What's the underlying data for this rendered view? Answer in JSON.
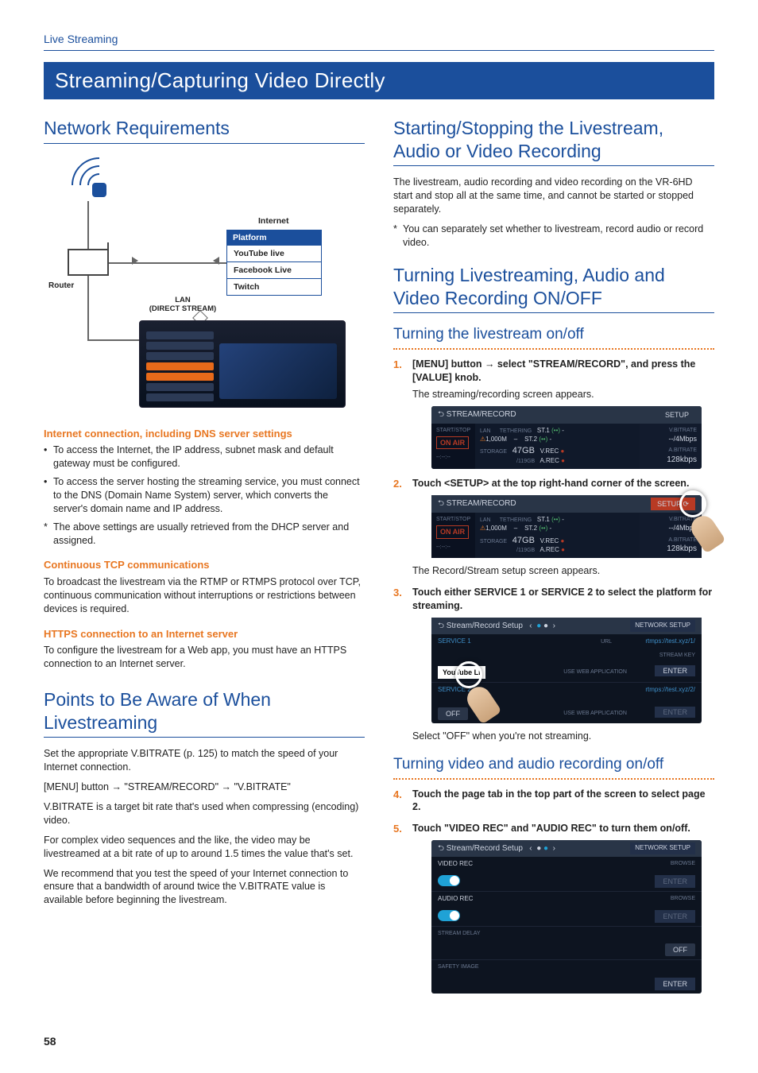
{
  "sectionLabel": "Live Streaming",
  "pageTitle": "Streaming/Capturing Video Directly",
  "pageNumber": "58",
  "left": {
    "h_network": "Network Requirements",
    "diagram": {
      "router": "Router",
      "internet": "Internet",
      "platform_head": "Platform",
      "platforms": [
        "YouTube live",
        "Facebook Live",
        "Twitch"
      ],
      "lan1": "LAN",
      "lan2": "(DIRECT STREAM)"
    },
    "h_internet": "Internet connection, including DNS server settings",
    "internet_b1": "To access the Internet, the IP address, subnet mask and default gateway must be configured.",
    "internet_b2": "To access the server hosting the streaming service, you must connect to the DNS (Domain Name System) server, which converts the server's domain name and IP address.",
    "internet_note": "The above settings are usually retrieved from the DHCP server and assigned.",
    "h_tcp": "Continuous TCP communications",
    "tcp_p": "To broadcast the livestream via the RTMP or RTMPS protocol over TCP, continuous communication without interruptions or restrictions between devices is required.",
    "h_https": "HTTPS connection to an Internet server",
    "https_p": "To configure the livestream for a Web app, you must have an HTTPS connection to an Internet server.",
    "h_points": "Points to Be Aware of When Livestreaming",
    "points_p1": "Set the appropriate V.BITRATE (p. 125) to match the speed of your Internet connection.",
    "points_p2": "[MENU] button → \"STREAM/RECORD\" → \"V.BITRATE\"",
    "points_p3": "V.BITRATE is a target bit rate that's used when compressing (encoding) video.",
    "points_p4": "For complex video sequences and the like, the video may be livestreamed at a bit rate of up to around 1.5 times the value that's set.",
    "points_p5": "We recommend that you test the speed of your Internet connection to ensure that a bandwidth of around twice the V.BITRATE value is available before beginning the livestream."
  },
  "right": {
    "h_start": "Starting/Stopping the Livestream, Audio or Video Recording",
    "start_p1": "The livestream, audio recording and video recording on the VR-6HD start and stop all at the same time, and cannot be started or stopped separately.",
    "start_note": "You can separately set whether to livestream, record audio or record video.",
    "h_turn": "Turning Livestreaming, Audio and Video Recording ON/OFF",
    "h_ls": "Turning the livestream on/off",
    "step1_num": "1.",
    "step1": "[MENU] button → select \"STREAM/RECORD\", and press the [VALUE] knob.",
    "step1_note": "The streaming/recording screen appears.",
    "step2_num": "2.",
    "step2": "Touch <SETUP> at the top right-hand corner of the screen.",
    "step2_note": "The Record/Stream setup screen appears.",
    "step3_num": "3.",
    "step3": "Touch either SERVICE 1 or SERVICE 2 to select the platform for streaming.",
    "step3_note": "Select \"OFF\" when you're not streaming.",
    "h_va": "Turning video and audio recording on/off",
    "step4_num": "4.",
    "step4": "Touch the page tab in the top part of the screen to select page 2.",
    "step5_num": "5.",
    "step5": "Touch \"VIDEO REC\" and \"AUDIO REC\" to turn them on/off.",
    "shot1": {
      "title": "STREAM/RECORD",
      "setup": "SETUP",
      "startstop": "START/STOP",
      "onair": "ON AIR",
      "lan": "LAN",
      "lanv": "1,000M",
      "teth": "TETHERING",
      "st1": "ST.1",
      "st2": "ST.2",
      "storage": "STORAGE",
      "gb": "47GB",
      "gb2": "/119GB",
      "vrec": "V.REC",
      "arec": "A.REC",
      "vbit": "V.BITRATE",
      "mbps": "--/4Mbps",
      "abit": "A.BITRATE",
      "kbps": "128kbps"
    },
    "shot3": {
      "title": "Stream/Record Setup",
      "ns": "NETWORK SETUP",
      "svc1": "SERVICE 1",
      "svc2": "SERVICE 2",
      "url_lbl": "URL",
      "url1": "rtmps://test.xyz/1/",
      "url2": "rtmps://test.xyz/2/",
      "key": "STREAM KEY",
      "web": "USE WEB APPLICATION",
      "enter": "ENTER",
      "yt": "YouTube Li",
      "off": "OFF"
    },
    "shot4": {
      "title": "Stream/Record Setup",
      "ns": "NETWORK SETUP",
      "vrec": "VIDEO REC",
      "arec": "AUDIO REC",
      "browse": "BROWSE",
      "delay": "STREAM DELAY",
      "safety": "SAFETY IMAGE",
      "enter": "ENTER",
      "off": "OFF"
    }
  }
}
